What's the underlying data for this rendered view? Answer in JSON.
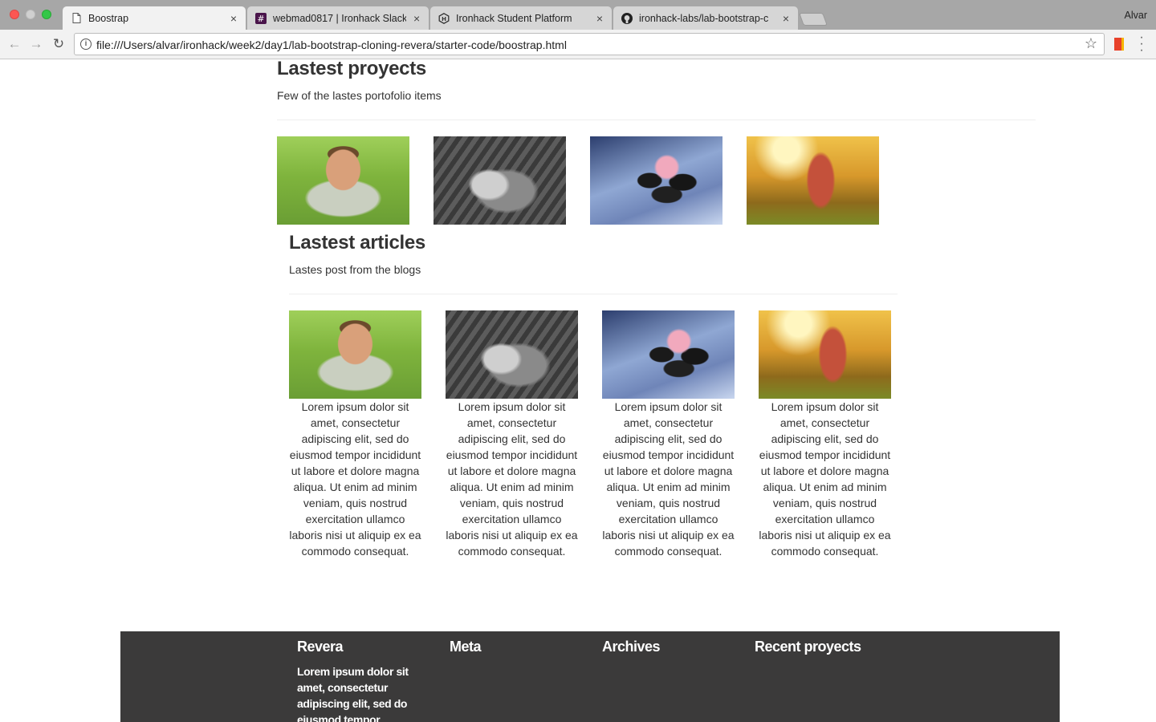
{
  "browser": {
    "tabs": [
      {
        "title": "Boostrap",
        "icon": "page-icon",
        "active": true
      },
      {
        "title": "webmad0817 | Ironhack Slack",
        "icon": "slack-hash-icon",
        "active": false
      },
      {
        "title": "Ironhack Student Platform",
        "icon": "ironhack-icon",
        "active": false
      },
      {
        "title": "ironhack-labs/lab-bootstrap-c",
        "icon": "github-icon",
        "active": false
      }
    ],
    "close_glyph": "×",
    "profile_name": "Alvar",
    "url": "file:///Users/alvar/ironhack/week2/day1/lab-bootstrap-cloning-revera/starter-code/boostrap.html"
  },
  "projects": {
    "title": "Lastest proyects",
    "subtitle": "Few of the lastes portofolio items",
    "images": [
      "pushup-man-photo",
      "kitten-photo",
      "rose-on-stones-photo",
      "girl-in-sunlight-photo"
    ]
  },
  "articles": {
    "title": "Lastest articles",
    "subtitle": "Lastes post from the blogs",
    "items": [
      {
        "image": "pushup-man-photo",
        "text": "Lorem ipsum dolor sit amet, consectetur adipiscing elit, sed do eiusmod tempor incididunt ut labore et dolore magna aliqua. Ut enim ad minim veniam, quis nostrud exercitation ullamco laboris nisi ut aliquip ex ea commodo consequat."
      },
      {
        "image": "kitten-photo",
        "text": "Lorem ipsum dolor sit amet, consectetur adipiscing elit, sed do eiusmod tempor incididunt ut labore et dolore magna aliqua. Ut enim ad minim veniam, quis nostrud exercitation ullamco laboris nisi ut aliquip ex ea commodo consequat."
      },
      {
        "image": "rose-on-stones-photo",
        "text": "Lorem ipsum dolor sit amet, consectetur adipiscing elit, sed do eiusmod tempor incididunt ut labore et dolore magna aliqua. Ut enim ad minim veniam, quis nostrud exercitation ullamco laboris nisi ut aliquip ex ea commodo consequat."
      },
      {
        "image": "girl-in-sunlight-photo",
        "text": "Lorem ipsum dolor sit amet, consectetur adipiscing elit, sed do eiusmod tempor incididunt ut labore et dolore magna aliqua. Ut enim ad minim veniam, quis nostrud exercitation ullamco laboris nisi ut aliquip ex ea commodo consequat."
      }
    ]
  },
  "footer": {
    "headings": [
      "Revera",
      "Meta",
      "Archives",
      "Recent proyects"
    ],
    "revera_text": "Lorem ipsum dolor sit amet, consectetur adipiscing elit, sed do eiusmod tempor",
    "background": "#3b3a3a"
  }
}
